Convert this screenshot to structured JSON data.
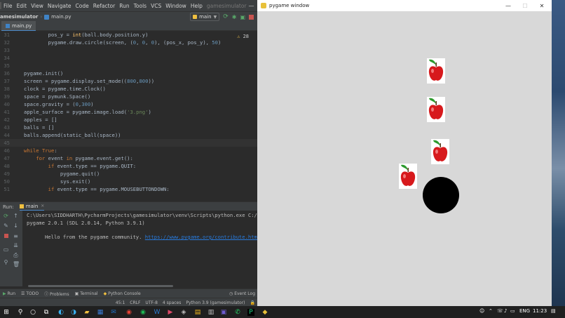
{
  "ide": {
    "menu": [
      "File",
      "Edit",
      "View",
      "Navigate",
      "Code",
      "Refactor",
      "Run",
      "Tools",
      "VCS",
      "Window",
      "Help"
    ],
    "project_hint": "gamesimulator",
    "project": "amesimulator",
    "breadcrumb_file": "main.py",
    "run_config": "main",
    "file_tab": "main.py",
    "warnings": "28",
    "code_lines": [
      {
        "n": "31",
        "html": "        pos_y = <span class='fn'>int</span>(ball.body.position.y)"
      },
      {
        "n": "32",
        "html": "        pygame.draw.circle(screen, (<span class='num'>0</span>, <span class='num'>0</span>, <span class='num'>0</span>), (pos_x, pos_y), <span class='num'>50</span>)"
      },
      {
        "n": "33",
        "html": ""
      },
      {
        "n": "34",
        "html": ""
      },
      {
        "n": "35",
        "html": ""
      },
      {
        "n": "36",
        "html": "pygame.init()"
      },
      {
        "n": "37",
        "html": "screen = pygame.display.set_mode((<span class='num'>800</span>,<span class='num'>800</span>))"
      },
      {
        "n": "38",
        "html": "clock = pygame.time.Clock()"
      },
      {
        "n": "39",
        "html": "space = pymunk.Space()"
      },
      {
        "n": "40",
        "html": "space.gravity = (<span class='num'>0</span>,<span class='num'>300</span>)"
      },
      {
        "n": "41",
        "html": "apple_surface = pygame.image.load(<span class='str'>'3.png'</span>)"
      },
      {
        "n": "42",
        "html": "apples = []"
      },
      {
        "n": "43",
        "html": "balls = []"
      },
      {
        "n": "44",
        "html": "balls.append(static_ball(space))"
      },
      {
        "n": "45",
        "html": ""
      },
      {
        "n": "46",
        "html": "<span class='kw'>while True</span>:"
      },
      {
        "n": "47",
        "html": "    <span class='kw'>for</span> event <span class='kw'>in</span> pygame.event.get():"
      },
      {
        "n": "48",
        "html": "        <span class='kw'>if</span> event.type == pygame.QUIT:"
      },
      {
        "n": "49",
        "html": "            pygame.quit()"
      },
      {
        "n": "50",
        "html": "            sys.exit()"
      },
      {
        "n": "51",
        "html": "        <span class='kw'>if</span> event.type == pygame.MOUSEBUTTONDOWN:"
      }
    ],
    "run_label": "Run:",
    "run_tab": "main",
    "output": {
      "line1": "C:\\Users\\SIDDHARTH\\PycharmProjects\\gamesimulator\\venv\\Scripts\\python.exe C:/Us",
      "line2": "pygame 2.0.1 (SDL 2.0.14, Python 3.9.1)",
      "line3_prefix": "Hello from the pygame community. ",
      "line3_link": "https://www.pygame.org/contribute.html"
    },
    "tool_tabs": [
      "Run",
      "TODO",
      "Problems",
      "Terminal",
      "Python Console"
    ],
    "event_log": "Event Log",
    "status": {
      "pos": "45:1",
      "crlf": "CRLF",
      "enc": "UTF-8",
      "indent": "4 spaces",
      "interp": "Python 3.9 (gamesimulator)"
    }
  },
  "pygame": {
    "title": "pygame window",
    "controls": {
      "min": "—",
      "max": "☐",
      "close": "✕"
    }
  },
  "taskbar": {
    "lang": "ENG",
    "time": "11:23"
  },
  "colors": {
    "accent": "#4a88c7",
    "apple_red": "#d7191c",
    "leaf": "#2d9a2d"
  }
}
